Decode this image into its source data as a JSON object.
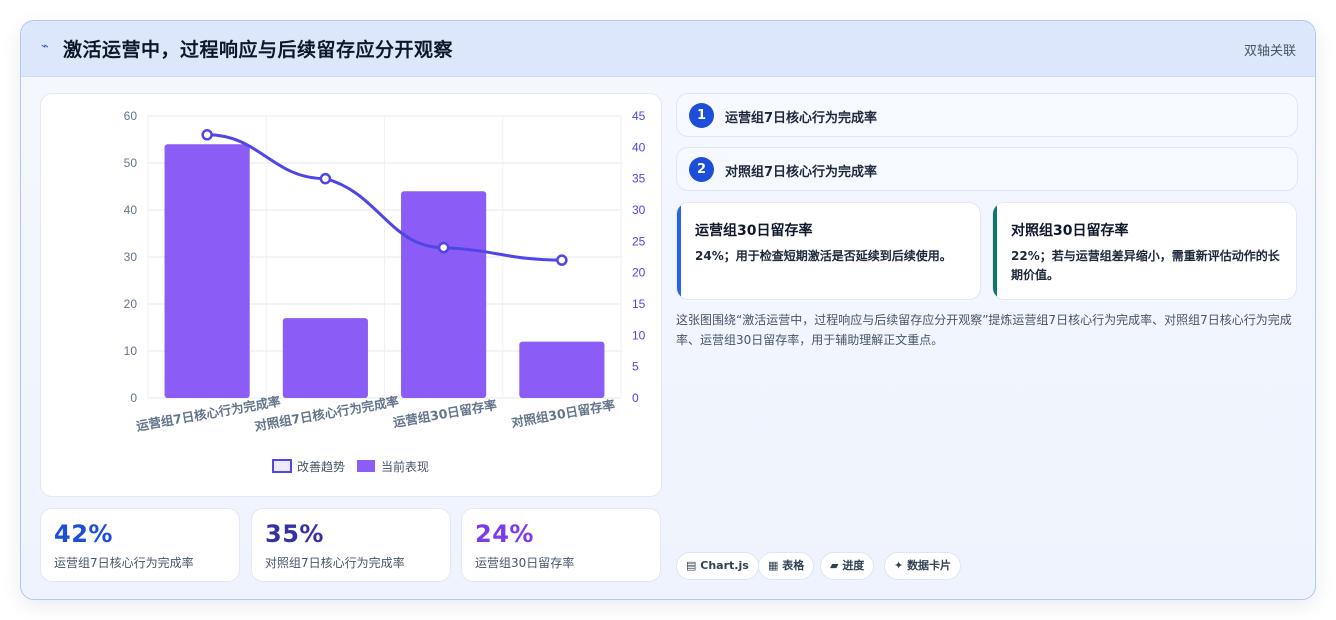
{
  "header": {
    "icon": "lightning-icon",
    "title": "激活运营中，过程响应与后续留存应分开观察",
    "tag": "双轴关联"
  },
  "chart_data": {
    "type": "bar",
    "categories": [
      "运营组7日核心行为完成率",
      "对照组7日核心行为完成率",
      "运营组30日留存率",
      "对照组30日留存率"
    ],
    "series": [
      {
        "name": "改善趋势",
        "type": "line",
        "axis": "right",
        "values": [
          42,
          35,
          24,
          22
        ],
        "color": "#4f46e5"
      },
      {
        "name": "当前表现",
        "type": "bar",
        "axis": "left",
        "values": [
          54,
          17,
          44,
          12
        ],
        "color": "#8b5cf6"
      }
    ],
    "ylim_left": [
      0,
      60
    ],
    "yticks_left": [
      0,
      10,
      20,
      30,
      40,
      50,
      60
    ],
    "ylim_right": [
      0,
      45
    ],
    "yticks_right": [
      0,
      5,
      10,
      15,
      20,
      25,
      30,
      35,
      40,
      45
    ],
    "grid": true,
    "legend_position": "bottom"
  },
  "stats": [
    {
      "value": "42%",
      "label": "运营组7日核心行为完成率",
      "color": "#1d4ed8"
    },
    {
      "value": "35%",
      "label": "对照组7日核心行为完成率",
      "color": "#3730a3"
    },
    {
      "value": "24%",
      "label": "运营组30日留存率",
      "color": "#7c3aed"
    }
  ],
  "steps": [
    {
      "num": "1",
      "text": "运营组7日核心行为完成率"
    },
    {
      "num": "2",
      "text": "对照组7日核心行为完成率"
    }
  ],
  "notes": [
    {
      "title": "运营组30日留存率",
      "body": "24%；用于检查短期激活是否延续到后续使用。",
      "accent": "#2563eb"
    },
    {
      "title": "对照组30日留存率",
      "body": "22%；若与运营组差异缩小，需重新评估动作的长期价值。",
      "accent": "#0f766e"
    }
  ],
  "summary": "这张图围绕“激活运营中，过程响应与后续留存应分开观察”提炼运营组7日核心行为完成率、对照组7日核心行为完成率、运营组30日留存率，用于辅助理解正文重点。",
  "pills": [
    {
      "icon": "chart-icon",
      "glyph": "▤",
      "label": "Chart.js"
    },
    {
      "icon": "table-icon",
      "glyph": "▦",
      "label": "表格"
    },
    {
      "icon": "progress-icon",
      "glyph": "▰",
      "label": "进度"
    },
    {
      "icon": "sparkle-icon",
      "glyph": "✦",
      "label": "数据卡片"
    }
  ]
}
